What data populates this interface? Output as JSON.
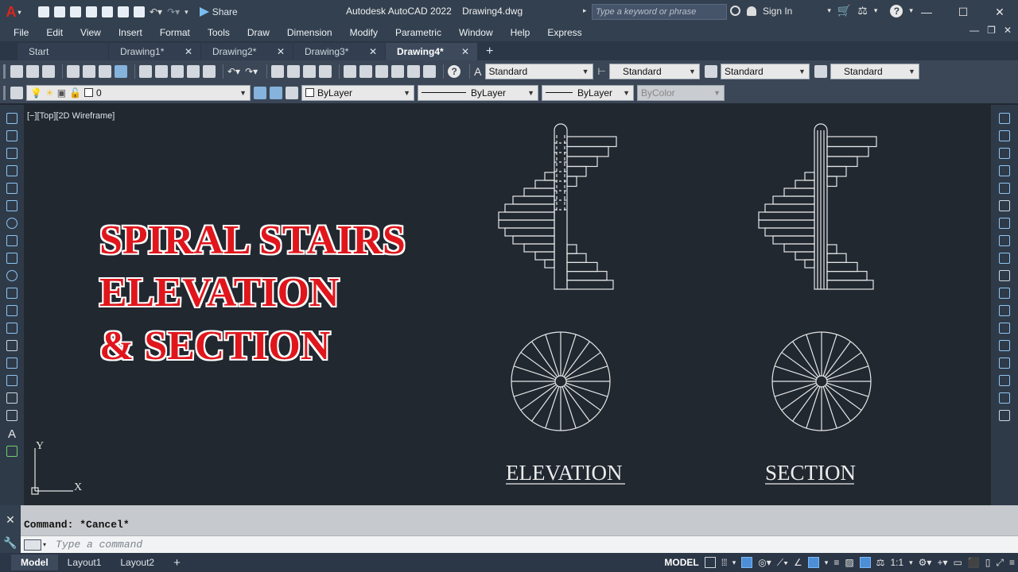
{
  "app": {
    "logo": "A",
    "title": "Autodesk AutoCAD 2022    Drawing4.dwg"
  },
  "quick_access": {
    "share_label": "Share"
  },
  "search": {
    "placeholder": "Type a keyword or phrase"
  },
  "account": {
    "signin_label": "Sign In"
  },
  "menu": [
    "File",
    "Edit",
    "View",
    "Insert",
    "Format",
    "Tools",
    "Draw",
    "Dimension",
    "Modify",
    "Parametric",
    "Window",
    "Help",
    "Express"
  ],
  "tabs": [
    {
      "label": "Start"
    },
    {
      "label": "Drawing1*",
      "close": "✕"
    },
    {
      "label": "Drawing2*",
      "close": "✕"
    },
    {
      "label": "Drawing3*",
      "close": "✕"
    },
    {
      "label": "Drawing4*",
      "close": "✕",
      "active": true
    }
  ],
  "styles_toolbar": {
    "text_style": "Standard",
    "dim_style": "Standard",
    "table_style": "Standard",
    "mleader_style": "Standard"
  },
  "properties_toolbar": {
    "layer": "0",
    "color": "ByLayer",
    "linetype": "ByLayer",
    "lineweight": "ByLayer",
    "plotstyle": "ByColor"
  },
  "viewport": {
    "label": "[−][Top][2D Wireframe]"
  },
  "drawing": {
    "title_lines": [
      "SPIRAL STAIRS",
      "ELEVATION",
      "& SECTION"
    ],
    "title_color": "#e0131c",
    "labels": {
      "elevation": "ELEVATION",
      "section": "SECTION"
    },
    "ucs": {
      "x": "X",
      "y": "Y"
    }
  },
  "command": {
    "history": "Command: *Cancel*",
    "placeholder": "Type a command"
  },
  "layouts": [
    {
      "label": "Model",
      "active": true
    },
    {
      "label": "Layout1"
    },
    {
      "label": "Layout2"
    }
  ],
  "status": {
    "space": "MODEL",
    "scale": "1:1"
  }
}
